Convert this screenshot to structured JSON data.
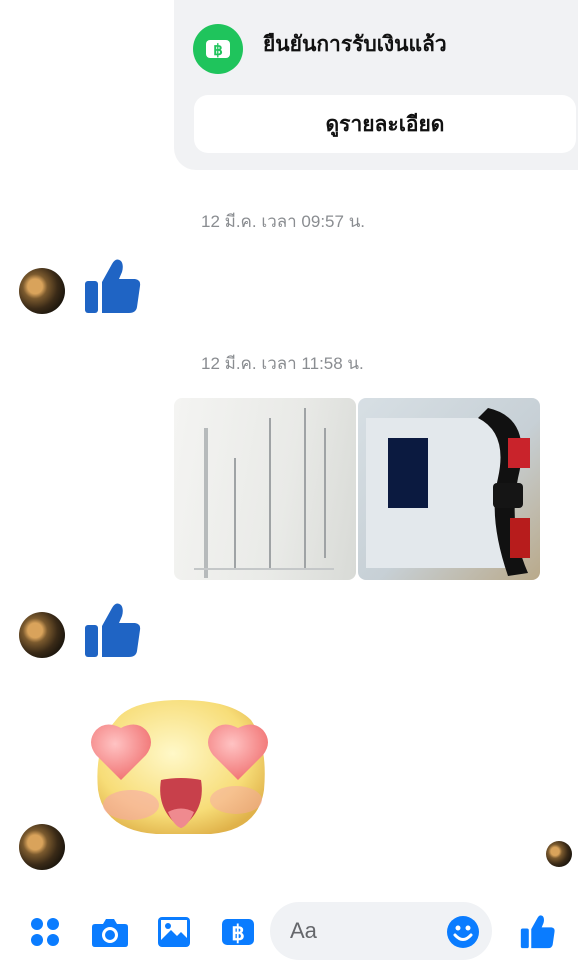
{
  "payment_card": {
    "title": "ยืนยันการรับเงินแล้ว",
    "detail_button": "ดูรายละเอียด"
  },
  "messages": {
    "timestamp_1": "12 มี.ค. เวลา 09:57 น.",
    "timestamp_2": "12 มี.ค. เวลา 11:58 น."
  },
  "composer": {
    "placeholder": "Aa"
  },
  "colors": {
    "messenger_blue": "#0a7cff",
    "thumbs_blue": "#1f64c4",
    "pay_green": "#1fc45c"
  },
  "icons": [
    "apps-icon",
    "camera-icon",
    "gallery-icon",
    "pay-icon",
    "emoji-icon",
    "like-icon"
  ]
}
